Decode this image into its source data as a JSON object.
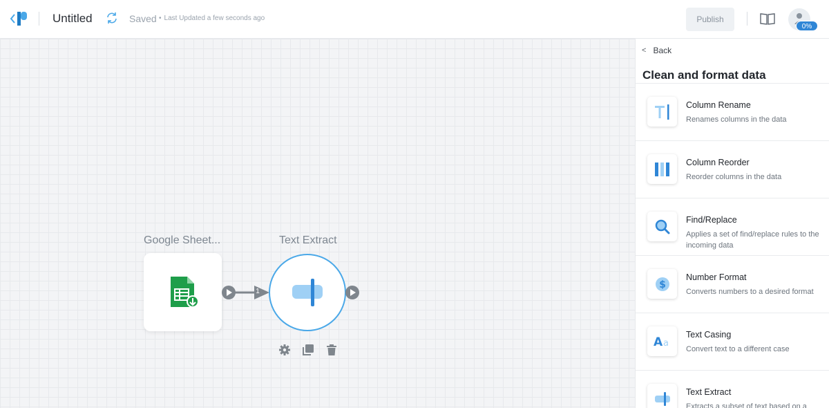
{
  "header": {
    "title": "Untitled",
    "saved": "Saved",
    "updated": "Last Updated a few seconds ago",
    "publish": "Publish",
    "progress": "0%"
  },
  "canvas": {
    "nodes": [
      {
        "label": "Google Sheet...",
        "icon": "google-sheets-icon"
      },
      {
        "label": "Text Extract",
        "icon": "text-extract-icon"
      }
    ],
    "connector_badge": "1"
  },
  "panel": {
    "back": "Back",
    "title": "Clean and format data",
    "items": [
      {
        "title": "Column Rename",
        "desc": "Renames columns in the data",
        "icon": "column-rename-icon"
      },
      {
        "title": "Column Reorder",
        "desc": "Reorder columns in the data",
        "icon": "column-reorder-icon"
      },
      {
        "title": "Find/Replace",
        "desc": "Applies a set of find/replace rules to the incoming data",
        "icon": "search-icon"
      },
      {
        "title": "Number Format",
        "desc": "Converts numbers to a desired format",
        "icon": "dollar-icon"
      },
      {
        "title": "Text Casing",
        "desc": "Convert text to a different case",
        "icon": "text-casing-icon"
      },
      {
        "title": "Text Extract",
        "desc": "Extracts a subset of text based on a",
        "icon": "text-extract-icon"
      }
    ]
  },
  "colors": {
    "accent": "#4aa8e8",
    "badge": "#2f86d6",
    "sheets_green": "#1e9e4a",
    "port_gray": "#7f868d"
  }
}
